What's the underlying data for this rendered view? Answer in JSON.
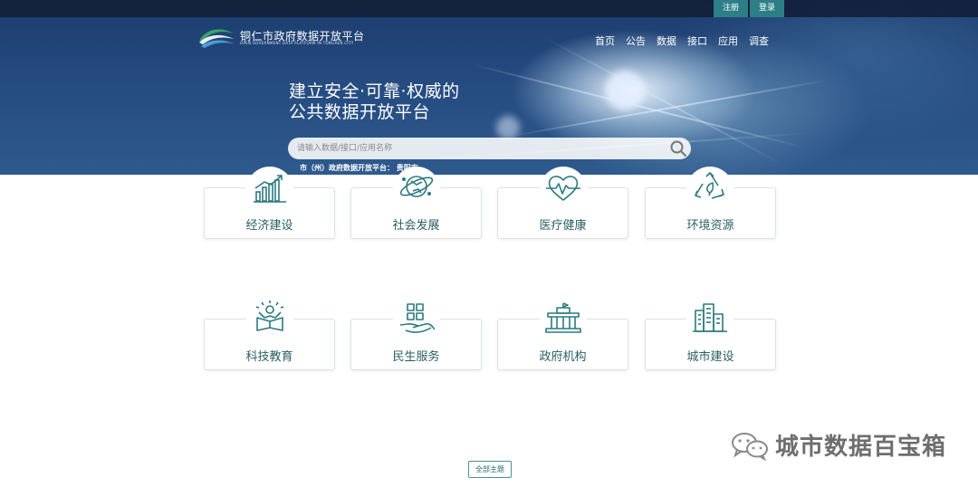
{
  "header": {
    "site_title": "铜仁市政府数据开放平台",
    "site_subtitle": "OPEN GOVERNMENT DATA PLATFORM IN TONGREN CITY",
    "register_label": "注册",
    "login_label": "登录",
    "nav": [
      "首页",
      "公告",
      "数据",
      "接口",
      "应用",
      "调查"
    ]
  },
  "hero": {
    "title_line1": "建立安全·可靠·权威的",
    "title_line2": "公共数据开放平台",
    "search_placeholder": "请输入数据/接口/应用名称",
    "note": "市（州）政府数据开放平台： 贵阳市"
  },
  "categories": [
    {
      "label": "经济建设",
      "icon": "economy-chart-icon"
    },
    {
      "label": "社会发展",
      "icon": "society-globe-icon"
    },
    {
      "label": "医疗健康",
      "icon": "health-heartbeat-icon"
    },
    {
      "label": "环境资源",
      "icon": "environment-recycle-icon"
    },
    {
      "label": "科技教育",
      "icon": "education-book-icon"
    },
    {
      "label": "民生服务",
      "icon": "service-hand-icon"
    },
    {
      "label": "政府机构",
      "icon": "government-building-icon"
    },
    {
      "label": "城市建设",
      "icon": "city-buildings-icon"
    }
  ],
  "footer": {
    "all_topics_label": "全部主题"
  },
  "watermark": {
    "text": "城市数据百宝箱"
  },
  "colors": {
    "accent": "#2c7f86",
    "icon_stroke": "#2b7a7f",
    "hero_bg": "#24497e"
  }
}
